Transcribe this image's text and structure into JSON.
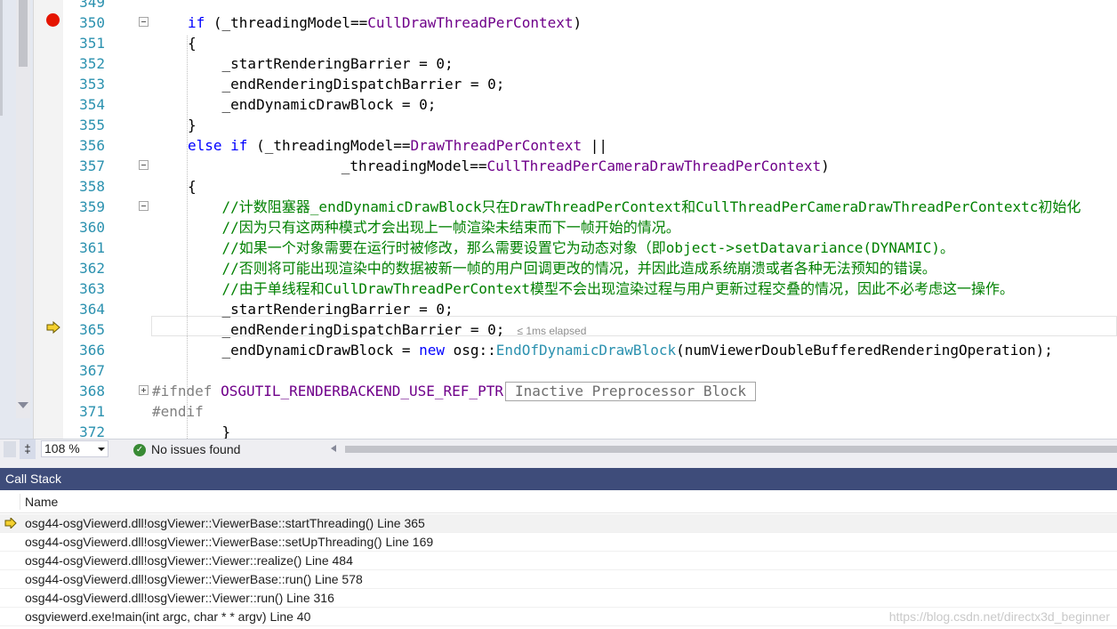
{
  "editor": {
    "lines": [
      {
        "n": "349",
        "parts": []
      },
      {
        "n": "350",
        "parts": [
          [
            "kw",
            "if"
          ],
          [
            "id",
            " (_threadingModel=="
          ],
          [
            "en",
            "CullDrawThreadPerContext"
          ],
          [
            "id",
            ")"
          ]
        ]
      },
      {
        "n": "351",
        "parts": [
          [
            "id",
            "{"
          ]
        ]
      },
      {
        "n": "352",
        "parts": [
          [
            "id",
            "    _startRenderingBarrier = 0;"
          ]
        ]
      },
      {
        "n": "353",
        "parts": [
          [
            "id",
            "    _endRenderingDispatchBarrier = 0;"
          ]
        ]
      },
      {
        "n": "354",
        "parts": [
          [
            "id",
            "    _endDynamicDrawBlock = 0;"
          ]
        ]
      },
      {
        "n": "355",
        "parts": [
          [
            "id",
            "}"
          ]
        ]
      },
      {
        "n": "356",
        "parts": [
          [
            "kw",
            "else if"
          ],
          [
            "id",
            " (_threadingModel=="
          ],
          [
            "en",
            "DrawThreadPerContext"
          ],
          [
            "id",
            " ||"
          ]
        ]
      },
      {
        "n": "357",
        "parts": [
          [
            "id",
            "         _threadingModel=="
          ],
          [
            "en",
            "CullThreadPerCameraDrawThreadPerContext"
          ],
          [
            "id",
            ")"
          ]
        ]
      },
      {
        "n": "358",
        "parts": [
          [
            "id",
            "{"
          ]
        ]
      },
      {
        "n": "359",
        "parts": [
          [
            "cm",
            "    //计数阻塞器_endDynamicDrawBlock只在DrawThreadPerContext和CullThreadPerCameraDrawThreadPerContextc初始化"
          ]
        ]
      },
      {
        "n": "360",
        "parts": [
          [
            "cm",
            "    //因为只有这两种模式才会出现上一帧渲染未结束而下一帧开始的情况。"
          ]
        ]
      },
      {
        "n": "361",
        "parts": [
          [
            "cm",
            "    //如果一个对象需要在运行时被修改，那么需要设置它为动态对象（即object->setDatavariance(DYNAMIC)。"
          ]
        ]
      },
      {
        "n": "362",
        "parts": [
          [
            "cm",
            "    //否则将可能出现渲染中的数据被新一帧的用户回调更改的情况，并因此造成系统崩溃或者各种无法预知的错误。"
          ]
        ]
      },
      {
        "n": "363",
        "parts": [
          [
            "cm",
            "    //由于单线程和CullDrawThreadPerContext模型不会出现渲染过程与用户更新过程交叠的情况，因此不必考虑这一操作。"
          ]
        ]
      },
      {
        "n": "364",
        "parts": [
          [
            "id",
            "    _startRenderingBarrier = 0;"
          ]
        ]
      },
      {
        "n": "365",
        "parts": [
          [
            "id",
            "    _endRenderingDispatchBarrier = 0;"
          ]
        ]
      },
      {
        "n": "366",
        "parts": [
          [
            "id",
            "    _endDynamicDrawBlock = "
          ],
          [
            "kw",
            "new"
          ],
          [
            "id",
            " osg::"
          ],
          [
            "ty",
            "EndOfDynamicDrawBlock"
          ],
          [
            "id",
            "(numViewerDoubleBufferedRenderingOperation);"
          ]
        ]
      },
      {
        "n": "367",
        "parts": []
      },
      {
        "n": "368",
        "parts": [
          [
            "pp",
            "#ifndef"
          ],
          [
            "id",
            " "
          ],
          [
            "en",
            "OSGUTIL_RENDERBACKEND_USE_REF_PTR"
          ]
        ]
      },
      {
        "n": "371",
        "parts": [
          [
            "pp",
            "#endif"
          ]
        ]
      },
      {
        "n": "372",
        "parts": [
          [
            "id",
            "    }"
          ]
        ]
      }
    ],
    "elapsed_hint": "≤ 1ms elapsed",
    "inactive_block_label": "Inactive Preprocessor Block"
  },
  "statusbar": {
    "tool_glyph": "‡",
    "zoom": "108 %",
    "issues": "No issues found"
  },
  "callstack": {
    "title": "Call Stack",
    "column_name": "Name",
    "rows": [
      "osg44-osgViewerd.dll!osgViewer::ViewerBase::startThreading() Line 365",
      "osg44-osgViewerd.dll!osgViewer::ViewerBase::setUpThreading() Line 169",
      "osg44-osgViewerd.dll!osgViewer::Viewer::realize() Line 484",
      "osg44-osgViewerd.dll!osgViewer::ViewerBase::run() Line 578",
      "osg44-osgViewerd.dll!osgViewer::Viewer::run() Line 316",
      "osgviewerd.exe!main(int argc, char * * argv) Line 40"
    ],
    "active_row": 0
  },
  "watermark": "https://blog.csdn.net/directx3d_beginner",
  "colors": {
    "keyword": "#0000ff",
    "comment": "#008000",
    "enum": "#6f008a",
    "type": "#2b91af",
    "line_number": "#2b91af",
    "breakpoint": "#e51400",
    "instruction_pointer": "#f5d130",
    "callstack_title_bg": "#3e4c7a"
  }
}
